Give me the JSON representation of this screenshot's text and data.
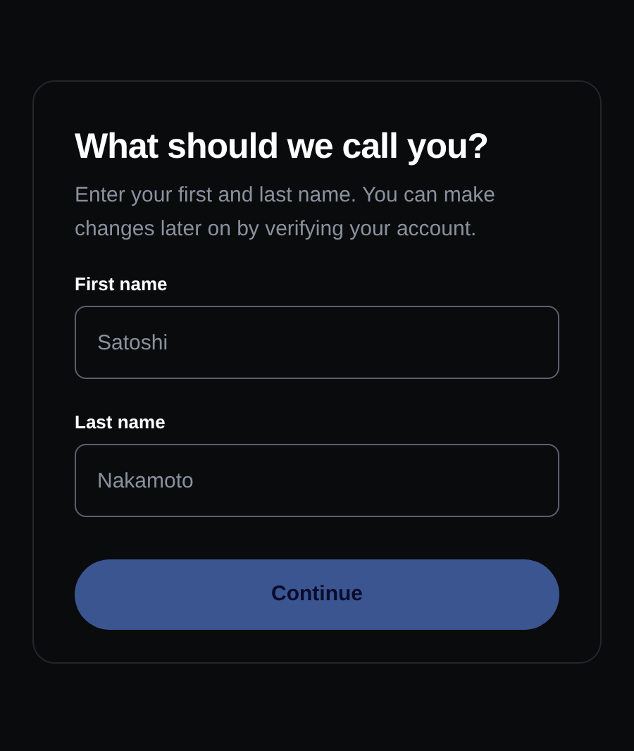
{
  "title": "What should we call you?",
  "subtitle": "Enter your first and last name. You can make changes later on by verifying your account.",
  "fields": [
    {
      "label": "First name",
      "placeholder": "Satoshi"
    },
    {
      "label": "Last name",
      "placeholder": "Nakamoto"
    }
  ],
  "button": {
    "label": "Continue",
    "disabled": true
  }
}
